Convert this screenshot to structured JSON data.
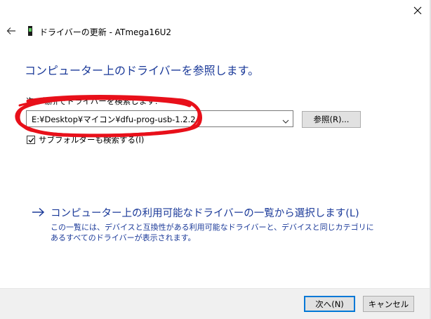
{
  "window": {
    "title": "ドライバーの更新 - ATmega16U2",
    "back_icon": "back-arrow-icon",
    "close_icon": "close-icon",
    "device_icon": "usb-device-icon"
  },
  "main": {
    "heading": "コンピューター上のドライバーを参照します。",
    "search_label": "次の場所でドライバーを検索します:",
    "path_value": "E:¥Desktop¥マイコン¥dfu-prog-usb-1.2.2",
    "browse_label": "参照(R)...",
    "subfolder_label": "サブフォルダーも検索する(I)",
    "subfolder_checked": true
  },
  "pick": {
    "link": "コンピューター上の利用可能なドライバーの一覧から選択します(L)",
    "desc": "この一覧には、デバイスと互換性がある利用可能なドライバーと、デバイスと同じカテゴリにあるすべてのドライバーが表示されます。"
  },
  "footer": {
    "next_label": "次へ(N)",
    "cancel_label": "キャンセル"
  },
  "colors": {
    "accent": "#1b3a99",
    "annotation": "#e8101a",
    "focus": "#0078d7"
  }
}
